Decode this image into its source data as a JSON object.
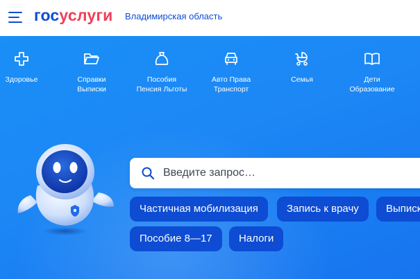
{
  "header": {
    "logo_part1": "гос",
    "logo_part2": "услуги",
    "region": "Владимирская область",
    "colors": {
      "brand_blue": "#0d4cd3",
      "brand_red": "#ee3f58"
    }
  },
  "categories": [
    {
      "icon": "plus-icon",
      "lines": [
        "Здоровье"
      ]
    },
    {
      "icon": "folder-icon",
      "lines": [
        "Справки",
        "Выписки"
      ]
    },
    {
      "icon": "money-bag-icon",
      "lines": [
        "Пособия",
        "Пенсия Льготы"
      ]
    },
    {
      "icon": "car-icon",
      "lines": [
        "Авто Права",
        "Транспорт"
      ]
    },
    {
      "icon": "stroller-icon",
      "lines": [
        "Семья"
      ]
    },
    {
      "icon": "book-icon",
      "lines": [
        "Дети",
        "Образование"
      ]
    }
  ],
  "search": {
    "placeholder": "Введите запрос…",
    "value": ""
  },
  "chips": [
    "Частичная мобилизация",
    "Запись к врачу",
    "Выписк",
    "Пособие 8—17",
    "Налоги"
  ],
  "banner": {
    "colors": {
      "top": "#1a8ff7",
      "bottom": "#1774ef",
      "chip": "#0d4cd3"
    }
  }
}
